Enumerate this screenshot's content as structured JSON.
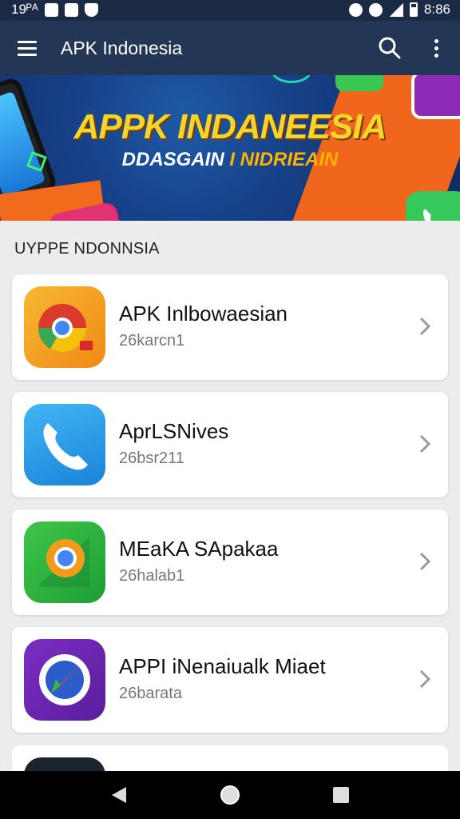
{
  "status_bar": {
    "time_left": "19ᴾᴬ",
    "time_right": "8:86"
  },
  "app_bar": {
    "title": "APK Indonesia",
    "menu_icon": "hamburger-menu-icon",
    "search_icon": "search-icon",
    "more_icon": "more-vert-icon"
  },
  "banner": {
    "title": "APPK INDANEESIA",
    "subtitle_part1": "DDASGAIN ",
    "subtitle_part2": "I NIDRIEAIN"
  },
  "section": {
    "title": "UYPPE NDONNSIA"
  },
  "apps": [
    {
      "name": "APK Inlbowaesian",
      "meta": "26karcn1",
      "icon": "chrome-browser-icon"
    },
    {
      "name": "AprLSNives",
      "meta": "26bsr211",
      "icon": "phone-icon"
    },
    {
      "name": "MEaKA SApakaa",
      "meta": "26halab1",
      "icon": "maps-icon"
    },
    {
      "name": "APPI iNenaiualk Miaet",
      "meta": "26barata",
      "icon": "compass-app-icon"
    }
  ],
  "colors": {
    "app_bar": "#233655",
    "status_bar": "#1c2b45",
    "banner_text": "#f7d42a",
    "background": "#ececef"
  }
}
